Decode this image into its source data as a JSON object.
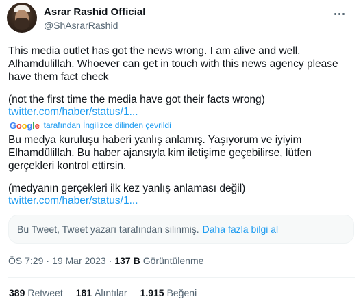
{
  "author": {
    "display_name": "Asrar Rashid Official",
    "handle": "@ShAsrarRashid"
  },
  "tweet": {
    "original_text": "This media outlet has got the news wrong. I am alive and well, Alhamdulillah. Whoever can get in touch with this news agency please have them fact check",
    "original_note": "(not the first time the media have got their facts wrong)",
    "link_1": "twitter.com/haber/status/1...",
    "translation_credit": "tarafından İngilizce dilinden çevrildi",
    "translated_text": "Bu medya kuruluşu haberi yanlış anlamış. Yaşıyorum ve iyiyim Elhamdülillah. Bu haber ajansıyla kim iletişime geçebilirse, lütfen gerçekleri kontrol ettirsin.",
    "translated_note": "(medyanın gerçekleri ilk kez yanlış anlaması değil)",
    "link_2": "twitter.com/haber/status/1..."
  },
  "translation_provider": {
    "letters": [
      "G",
      "o",
      "o",
      "g",
      "l",
      "e"
    ]
  },
  "deleted_notice": {
    "text": "Bu Tweet, Tweet yazarı tarafından silinmiş.",
    "learn_more": "Daha fazla bilgi al"
  },
  "meta": {
    "time": "ÖS 7:29",
    "separator": "·",
    "date": "19 Mar 2023",
    "views_count": "137 B",
    "views_label": "Görüntülenme"
  },
  "stats": {
    "retweets_count": "389",
    "retweets_label": "Retweet",
    "quotes_count": "181",
    "quotes_label": "Alıntılar",
    "likes_count": "1.915",
    "likes_label": "Beğeni"
  },
  "icons": {
    "more": "more-horizontal-icon"
  },
  "colors": {
    "link": "#1d9bf0",
    "text": "#0f1419",
    "secondary": "#536471",
    "box_bg": "#f7f9f9"
  }
}
